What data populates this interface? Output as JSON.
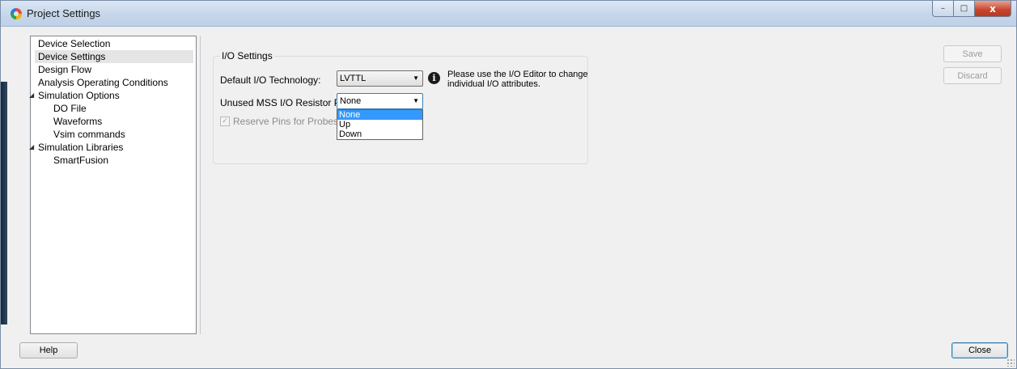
{
  "window": {
    "title": "Project Settings"
  },
  "caption": {
    "minimize": "–",
    "maximize": "□",
    "close": "x"
  },
  "tree": {
    "items": [
      {
        "label": "Device Selection"
      },
      {
        "label": "Device Settings",
        "selected": true
      },
      {
        "label": "Design Flow"
      },
      {
        "label": "Analysis Operating Conditions"
      },
      {
        "label": "Simulation Options",
        "expanded": true
      },
      {
        "label": "DO File"
      },
      {
        "label": "Waveforms"
      },
      {
        "label": "Vsim commands"
      },
      {
        "label": "Simulation Libraries",
        "expanded": true
      },
      {
        "label": "SmartFusion"
      }
    ]
  },
  "io_settings": {
    "group_title": "I/O Settings",
    "default_io_label": "Default I/O Technology:",
    "default_io_value": "LVTTL",
    "info_text": "Please use the I/O Editor to change individual I/O attributes.",
    "unused_mss_label": "Unused MSS I/O Resistor Pull:",
    "unused_mss_value": "None",
    "unused_mss_options": [
      "None",
      "Up",
      "Down"
    ],
    "reserve_pins_label": "Reserve Pins for Probes",
    "reserve_pins_checked": true
  },
  "buttons": {
    "save": "Save",
    "discard": "Discard",
    "help": "Help",
    "close": "Close"
  },
  "colors": {
    "selection_highlight": "#3399ff",
    "titlebar": "#c6d6ea",
    "close_button": "#c7432b"
  }
}
